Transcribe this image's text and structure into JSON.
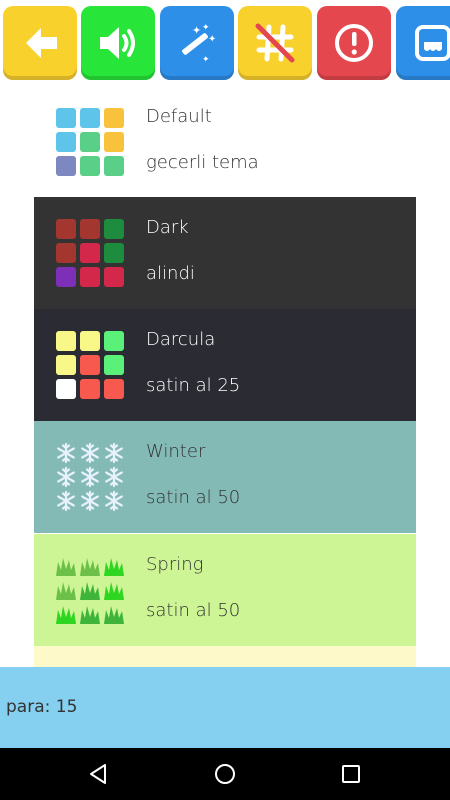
{
  "toolbar": {
    "buttons": [
      {
        "icon": "back-arrow-icon",
        "color": "#f9d12d"
      },
      {
        "icon": "speaker-icon",
        "color": "#28e53a"
      },
      {
        "icon": "magic-wand-icon",
        "color": "#2e8fe8"
      },
      {
        "icon": "hashtag-off-icon",
        "color": "#f9d12d"
      },
      {
        "icon": "alert-icon",
        "color": "#e4474d"
      },
      {
        "icon": "app-icon",
        "color": "#2e8fe8"
      }
    ]
  },
  "themes": [
    {
      "name": "Default",
      "status": "gecerli tema",
      "background": "#ffffff",
      "text_color": "#333333"
    },
    {
      "name": "Dark",
      "status": "alindi",
      "background": "#333333",
      "text_color": "#ffffff"
    },
    {
      "name": "Darcula",
      "status": "satin al 25",
      "background": "#2b2b33",
      "text_color": "#ffffff"
    },
    {
      "name": "Winter",
      "status": "satin al 50",
      "background": "#84bab6",
      "text_color": "#333333"
    },
    {
      "name": "Spring",
      "status": "satin al 50",
      "background": "#cdf596",
      "text_color": "#333333"
    }
  ],
  "next_theme_color": "#fef9c8",
  "footer": {
    "money": "para: 15"
  },
  "navbar": {
    "icons": [
      "back-nav-icon",
      "home-nav-icon",
      "recents-nav-icon"
    ]
  }
}
